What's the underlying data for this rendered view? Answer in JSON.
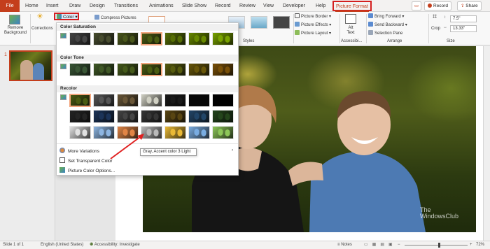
{
  "tabs": {
    "file": "File",
    "items": [
      "Home",
      "Insert",
      "Draw",
      "Design",
      "Transitions",
      "Animations",
      "Slide Show",
      "Record",
      "Review",
      "View",
      "Developer",
      "Help"
    ],
    "active": "Picture Format",
    "record_button": "Record",
    "share_button": "Share"
  },
  "ribbon": {
    "remove_background": "Remove Background",
    "corrections": "Corrections",
    "color": "Color",
    "compress_pictures": "Compress Pictures",
    "picture_border": "Picture Border",
    "picture_effects": "Picture Effects",
    "picture_layout": "Picture Layout",
    "styles_group": "Styles",
    "alt_text": "Alt Text",
    "accessibility_group": "Accessibi...",
    "bring_forward": "Bring Forward",
    "send_backward": "Send Backward",
    "selection_pane": "Selection Pane",
    "arrange_group": "Arrange",
    "crop": "Crop",
    "height_value": "7.5\"",
    "width_value": "13.33\"",
    "size_group": "Size"
  },
  "color_menu": {
    "saturation_heading": "Color Saturation",
    "tone_heading": "Color Tone",
    "recolor_heading": "Recolor",
    "more_variations": "More Variations",
    "set_transparent": "Set Transparent Color",
    "picture_color_options": "Picture Color Options...",
    "tooltip": "Gray, Accent color 3 Light",
    "saturation_swatches": [
      {
        "name": "saturation-0",
        "tint": "#4a4a4a"
      },
      {
        "name": "saturation-33",
        "tint": "#4d5236"
      },
      {
        "name": "saturation-66",
        "tint": "#4e5a24"
      },
      {
        "name": "saturation-100",
        "tint": "#4f5f1c"
      },
      {
        "name": "saturation-200",
        "tint": "#5a7010"
      },
      {
        "name": "saturation-300",
        "tint": "#6a8805"
      },
      {
        "name": "saturation-400",
        "tint": "#7aa000"
      }
    ],
    "tone_swatches": [
      {
        "name": "temperature-4700",
        "tint": "#3f5a3c"
      },
      {
        "name": "temperature-5300",
        "tint": "#455c2e"
      },
      {
        "name": "temperature-5900",
        "tint": "#4a5d24"
      },
      {
        "name": "temperature-6500",
        "tint": "#4f5f1c"
      },
      {
        "name": "temperature-7200",
        "tint": "#5a5e18"
      },
      {
        "name": "temperature-8800",
        "tint": "#6a5a14"
      },
      {
        "name": "temperature-11200",
        "tint": "#7a5412"
      }
    ],
    "recolor_rows": [
      [
        {
          "name": "no-recolor",
          "tint": "#4f5f1c"
        },
        {
          "name": "grayscale",
          "tint": "#5a5a5a"
        },
        {
          "name": "sepia",
          "tint": "#6b5a3e"
        },
        {
          "name": "washout",
          "tint": "#c9c9bd"
        },
        {
          "name": "black-white-25",
          "tint": "#222222"
        },
        {
          "name": "black-white-50",
          "tint": "#111111"
        },
        {
          "name": "black-white-75",
          "tint": "#000000"
        }
      ],
      [
        {
          "name": "black-text-dark-1",
          "tint": "#2c2c2c"
        },
        {
          "name": "blue-accent-1-dark",
          "tint": "#243a5c"
        },
        {
          "name": "orange-accent-2-dark",
          "tint": "#4a4a4a"
        },
        {
          "name": "gray-accent-3-dark",
          "tint": "#3c3c3c"
        },
        {
          "name": "gold-accent-4-dark",
          "tint": "#5c4a1c"
        },
        {
          "name": "blue-accent-5-dark",
          "tint": "#2a4a6a"
        },
        {
          "name": "green-accent-6-dark",
          "tint": "#2c4a24"
        }
      ],
      [
        {
          "name": "white-background-light",
          "tint": "#d8d8d8"
        },
        {
          "name": "blue-accent-1-light",
          "tint": "#8cb0d8"
        },
        {
          "name": "orange-accent-2-light",
          "tint": "#d8844a"
        },
        {
          "name": "gray-accent-3-light",
          "tint": "#b4b4b4"
        },
        {
          "name": "gold-accent-4-light",
          "tint": "#e0b43c"
        },
        {
          "name": "blue-accent-5-light",
          "tint": "#7aa8d8"
        },
        {
          "name": "green-accent-6-light",
          "tint": "#8cc05c"
        }
      ]
    ]
  },
  "statusbar": {
    "slide_info": "Slide 1 of 1",
    "language": "English (United States)",
    "accessibility": "Accessibility: Investigate",
    "notes": "Notes",
    "zoom": "72%"
  },
  "thumb": {
    "number": "1"
  },
  "watermark": {
    "line1": "The",
    "line2": "WindowsClub"
  },
  "colors": {
    "accent": "#c43e1c",
    "highlight": "#d42020"
  }
}
